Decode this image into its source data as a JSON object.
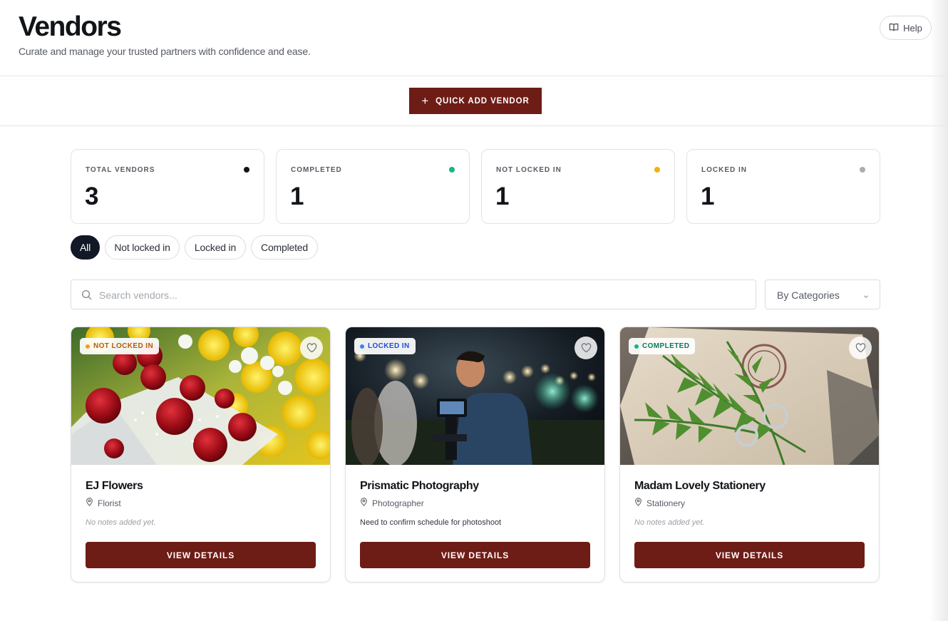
{
  "header": {
    "title": "Vendors",
    "subtitle": "Curate and manage your trusted partners with confidence and ease.",
    "help_label": "Help"
  },
  "actions": {
    "quick_add_label": "QUICK ADD VENDOR"
  },
  "stats": [
    {
      "label": "TOTAL VENDORS",
      "value": "3",
      "dot_color": "#111418"
    },
    {
      "label": "COMPLETED",
      "value": "1",
      "dot_color": "#12b981"
    },
    {
      "label": "NOT LOCKED IN",
      "value": "1",
      "dot_color": "#f2b10a"
    },
    {
      "label": "LOCKED IN",
      "value": "1",
      "dot_color": "#a9adb2"
    }
  ],
  "filters": {
    "tabs": [
      "All",
      "Not locked in",
      "Locked in",
      "Completed"
    ],
    "active": "All"
  },
  "search": {
    "placeholder": "Search vendors...",
    "value": ""
  },
  "category_filter": {
    "selected": "By Categories"
  },
  "vendors": [
    {
      "name": "EJ Flowers",
      "category": "Florist",
      "status": "NOT LOCKED IN",
      "status_color": "#b9590a",
      "status_dot": "#f59e0b",
      "note": "No notes added yet.",
      "note_empty": true,
      "button_label": "VIEW DETAILS"
    },
    {
      "name": "Prismatic Photography",
      "category": "Photographer",
      "status": "LOCKED IN",
      "status_color": "#1d4ed8",
      "status_dot": "#3b82f6",
      "note": "Need to confirm schedule for photoshoot",
      "note_empty": false,
      "button_label": "VIEW DETAILS"
    },
    {
      "name": "Madam Lovely Stationery",
      "category": "Stationery",
      "status": "COMPLETED",
      "status_color": "#047857",
      "status_dot": "#10b981",
      "note": "No notes added yet.",
      "note_empty": true,
      "button_label": "VIEW DETAILS"
    }
  ],
  "colors": {
    "accent": "#6e1c16",
    "active_pill": "#121826"
  }
}
